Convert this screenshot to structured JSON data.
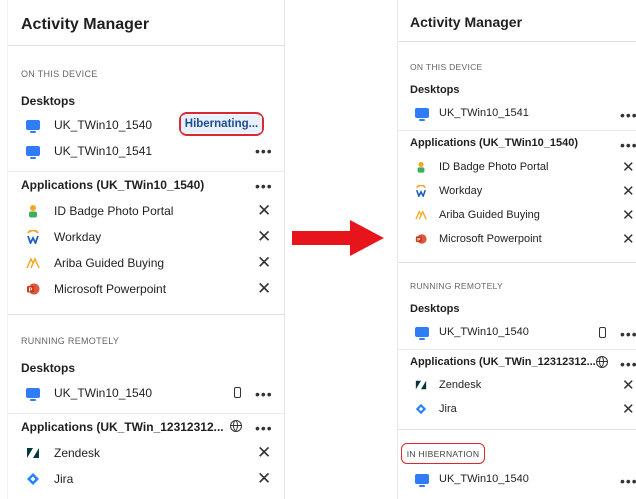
{
  "left": {
    "title": "Activity Manager",
    "section_device": "ON THIS DEVICE",
    "desktops_header": "Desktops",
    "desktops": [
      "UK_TWin10_1540",
      "UK_TWin10_1541"
    ],
    "hibernating_button": "Hibernating...",
    "apps_header": "Applications (UK_TWin10_1540)",
    "apps": [
      "ID Badge Photo Portal",
      "Workday",
      "Ariba Guided Buying",
      "Microsoft Powerpoint"
    ],
    "section_remote": "RUNNING REMOTELY",
    "remote_desktops_header": "Desktops",
    "remote_desktop": "UK_TWin10_1540",
    "remote_apps_header": "Applications (UK_TWin_12312312...",
    "remote_apps": [
      "Zendesk",
      "Jira"
    ]
  },
  "right": {
    "title": "Activity Manager",
    "section_device": "ON THIS DEVICE",
    "desktops_header": "Desktops",
    "desktop": "UK_TWin10_1541",
    "apps_header": "Applications (UK_TWin10_1540)",
    "apps": [
      "ID Badge Photo Portal",
      "Workday",
      "Ariba Guided Buying",
      "Microsoft Powerpoint"
    ],
    "section_remote": "RUNNING REMOTELY",
    "remote_desktops_header": "Desktops",
    "remote_desktop": "UK_TWin10_1540",
    "remote_apps_header": "Applications (UK_TWin_12312312...",
    "remote_apps": [
      "Zendesk",
      "Jira"
    ],
    "section_hibernation": "IN HIBERNATION",
    "hibernation_desktop": "UK_TWin10_1540"
  },
  "icons": {
    "desktop": "monitor-icon",
    "id_badge": "id-badge-icon",
    "workday": "workday-icon",
    "ariba": "ariba-icon",
    "powerpoint": "powerpoint-icon",
    "zendesk": "zendesk-icon",
    "jira": "jira-icon",
    "more": "ellipsis-icon",
    "close": "close-icon",
    "mobile": "mobile-icon",
    "globe": "globe-icon",
    "arrow": "arrow-right-icon"
  },
  "colors": {
    "accent_blue": "#2f7cf6",
    "highlight_red": "#d9282f",
    "hibernating_bg": "#e7f0fb",
    "hibernating_text": "#1d4f91",
    "arrow_red": "#e8141c"
  }
}
